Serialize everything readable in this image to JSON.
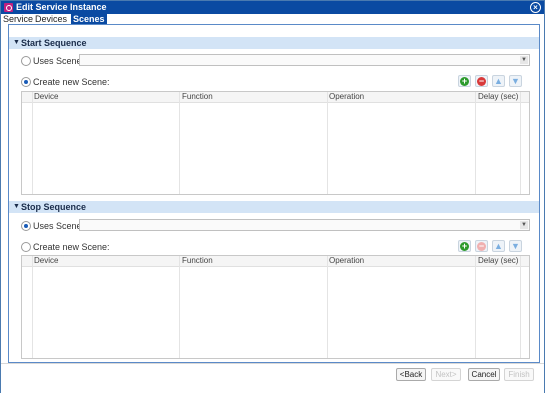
{
  "window": {
    "title": "Edit Service Instance"
  },
  "tabs": [
    {
      "label": "Service"
    },
    {
      "label": "Devices"
    },
    {
      "label": "Scenes"
    }
  ],
  "start_sequence": {
    "title": "Start Sequence",
    "uses_scene_label": "Uses Scene:",
    "create_new_label": "Create new Scene:",
    "selected_option": "create_new",
    "columns": [
      "Device",
      "Function",
      "Operation",
      "Delay (sec)"
    ]
  },
  "stop_sequence": {
    "title": "Stop Sequence",
    "uses_scene_label": "Uses Scene:",
    "create_new_label": "Create new Scene:",
    "selected_option": "uses_scene",
    "columns": [
      "Device",
      "Function",
      "Operation",
      "Delay (sec)"
    ]
  },
  "buttons": {
    "back": "<Back",
    "next": "Next>",
    "cancel": "Cancel",
    "finish": "Finish"
  },
  "icons": {
    "add": "plus-icon",
    "remove": "minus-icon",
    "up": "arrow-up-icon",
    "down": "arrow-down-icon"
  },
  "colors": {
    "title_bar": "#0a4aa2",
    "section_header": "#d3e4f6",
    "add_green": "#2c9a2c",
    "remove_red": "#d83a3a"
  }
}
